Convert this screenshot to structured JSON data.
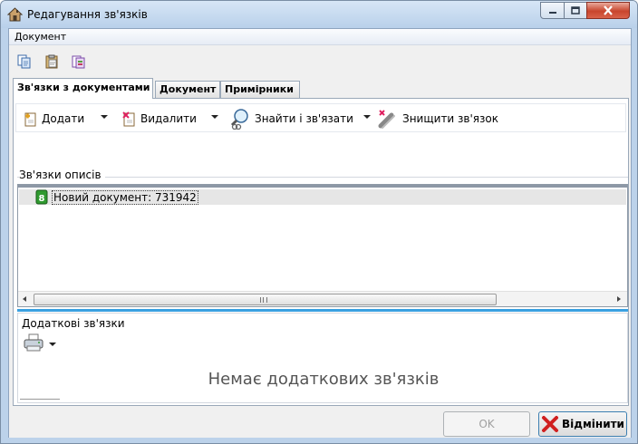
{
  "window": {
    "title": "Редагування зв'язків",
    "accent": "#bcd2ea",
    "close_color": "#c8452d"
  },
  "menubar": {
    "items": [
      {
        "label": "Документ"
      }
    ]
  },
  "quick_toolbar": {
    "icons": [
      "copy-icon",
      "paste-icon",
      "document-properties-icon"
    ]
  },
  "tabs": [
    {
      "label": "Зв'язки з документами",
      "active": true
    },
    {
      "label": "Документ",
      "active": false
    },
    {
      "label": "Примірники",
      "active": false
    }
  ],
  "links_toolbar": {
    "add_label": "Додати",
    "delete_label": "Видалити",
    "find_link_label": "Знайти і зв'язати",
    "destroy_link_label": "Знищити зв'язок"
  },
  "descriptions_group": {
    "title": "Зв'язки описів",
    "rows": [
      {
        "label": "Новий документ: 731942",
        "icon": "document-green-icon"
      }
    ]
  },
  "additional_group": {
    "title": "Додаткові зв'язки",
    "empty_message": "Немає додаткових зв'язків"
  },
  "footer": {
    "ok_label": "OK",
    "cancel_label": "Відмінити"
  }
}
